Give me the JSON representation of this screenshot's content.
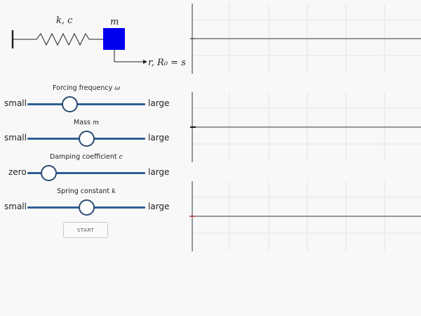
{
  "diagram": {
    "spring_label": "k, c",
    "mass_label": "m",
    "output_label": "r, R₀ = s",
    "colors": {
      "mass": "#0000ee",
      "spring": "#222222"
    }
  },
  "controls": [
    {
      "title_text": "Forcing frequency ",
      "title_symbol": "ω",
      "left": "small",
      "right": "large",
      "value": 0.36
    },
    {
      "title_text": "Mass ",
      "title_symbol": "m",
      "left": "small",
      "right": "large",
      "value": 0.5
    },
    {
      "title_text": "Damping coefficient ",
      "title_symbol": "c",
      "left": "zero",
      "right": "large",
      "value": 0.18
    },
    {
      "title_text": "Spring constant ",
      "title_symbol": "k",
      "left": "small",
      "right": "large",
      "value": 0.5
    }
  ],
  "start_button": {
    "label": "START"
  },
  "colors": {
    "track": "#2f5f95",
    "thumb_border": "#2b4c73",
    "grid": "#e4e4e4",
    "axis": "#333333"
  }
}
